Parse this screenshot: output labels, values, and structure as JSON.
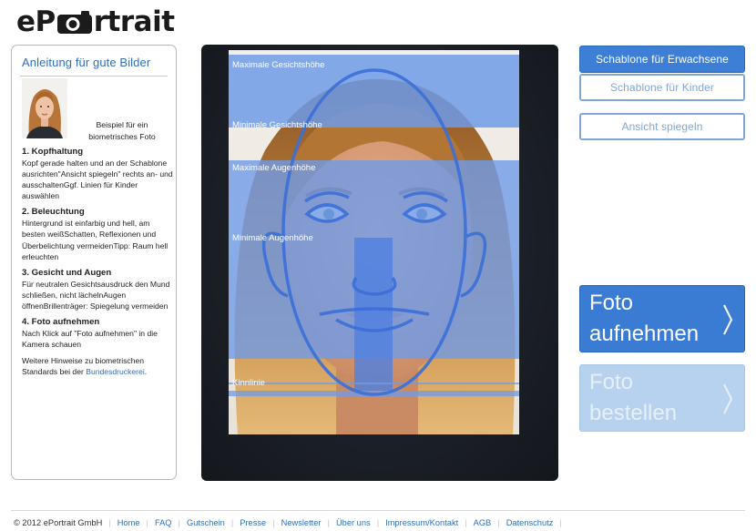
{
  "brand": {
    "logo_left": "eP",
    "logo_right": "rtrait"
  },
  "guide": {
    "title": "Anleitung für gute Bilder",
    "sample_caption": "Beispiel für ein biometrisches Foto",
    "sections": [
      {
        "title": "1. Kopfhaltung",
        "text": "Kopf gerade halten und an der Schablone ausrichten\"Ansicht spiegeln\" rechts an- und ausschaltenGgf. Linien für Kinder auswählen"
      },
      {
        "title": "2. Beleuchtung",
        "text": "Hintergrund ist einfarbig und hell, am besten weißSchatten, Reflexionen und Überbelichtung vermeidenTipp: Raum hell erleuchten"
      },
      {
        "title": "3. Gesicht und Augen",
        "text": "Für neutralen Gesichtsausdruck den Mund schließen, nicht lächelnAugen öffnenBrillenträger: Spiegelung vermeiden"
      },
      {
        "title": "4. Foto aufnehmen",
        "text": "Nach Klick auf \"Foto aufnehmen\" in die Kamera schauen"
      }
    ],
    "hint_prefix": "Weitere Hinweise zu biometrischen Standards bei der ",
    "hint_link": "Bundesdruckerei",
    "hint_suffix": "."
  },
  "template": {
    "max_face_height": "Maximale Gesichtshöhe",
    "min_face_height": "Minimale Gesichtshöhe",
    "max_eye_height": "Maximale Augenhöhe",
    "min_eye_height": "Minimale Augenhöhe",
    "chin_line": "Kinnlinie"
  },
  "controls": {
    "adult_template": "Schablone für Erwachsene",
    "child_template": "Schablone für Kinder",
    "mirror_view": "Ansicht spiegeln",
    "take_photo_line1": "Foto",
    "take_photo_line2": "aufnehmen",
    "order_photo_line1": "Foto",
    "order_photo_line2": "bestellen"
  },
  "footer": {
    "copyright": "© 2012 ePortrait GmbH",
    "links": [
      "Home",
      "FAQ",
      "Gutschein",
      "Presse",
      "Newsletter",
      "Über uns",
      "Impressum/Kontakt",
      "AGB",
      "Datenschutz"
    ]
  },
  "colors": {
    "accent": "#3a7bd4",
    "disabled": "#b7d2ee",
    "link": "#2f6fb6",
    "overlay": "#6f9be8"
  }
}
